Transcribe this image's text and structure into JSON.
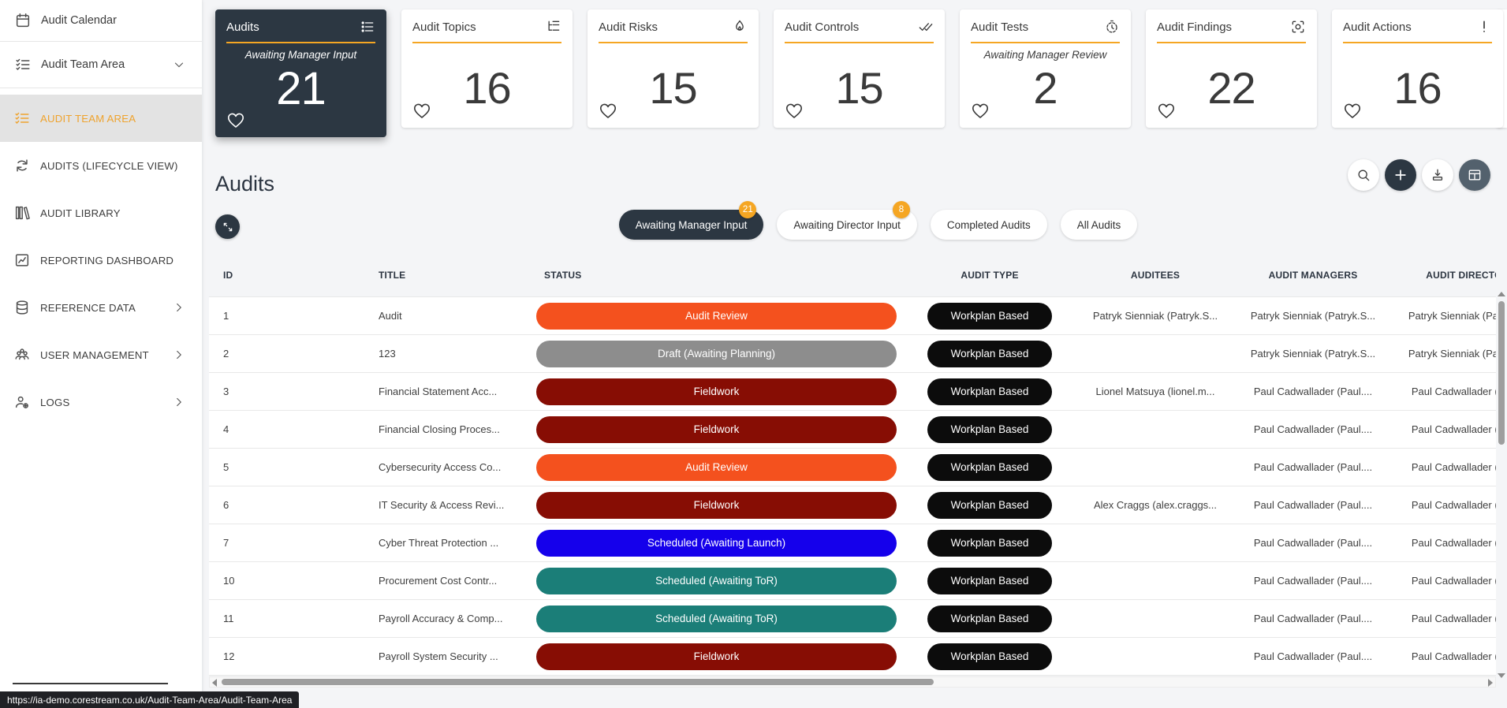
{
  "app": {
    "url_tooltip": "https://ia-demo.corestream.co.uk/Audit-Team-Area/Audit-Team-Area"
  },
  "colors": {
    "accent_orange": "#f5a623",
    "dark": "#2c3742",
    "slate": "#53616d",
    "active_item_text": "#efa32e",
    "page_bg": "#f4f5f7",
    "audit_type_pill": "#0c0c0c",
    "badge": "#f5a623",
    "status": {
      "audit_review": "#f4511e",
      "draft": "#8d8d8d",
      "fieldwork": "#870d04",
      "scheduled_launch": "#1500eb",
      "scheduled_tor": "#1b7e78"
    }
  },
  "sidebar": {
    "top_items": [
      {
        "label": "Audit Calendar",
        "icon": "calendar-icon"
      },
      {
        "label": "Audit Team Area",
        "icon": "checklist-icon",
        "chevron": "down"
      }
    ],
    "items": [
      {
        "label": "AUDIT TEAM AREA",
        "icon": "checklist-icon",
        "active": true
      },
      {
        "label": "AUDITS (LIFECYCLE VIEW)",
        "icon": "lifecycle-icon"
      },
      {
        "label": "AUDIT LIBRARY",
        "icon": "library-icon"
      },
      {
        "label": "REPORTING DASHBOARD",
        "icon": "chart-icon"
      },
      {
        "label": "REFERENCE DATA",
        "icon": "database-icon",
        "chevron": "right"
      },
      {
        "label": "USER MANAGEMENT",
        "icon": "users-icon",
        "chevron": "right"
      },
      {
        "label": "LOGS",
        "icon": "user-log-icon",
        "chevron": "right"
      }
    ]
  },
  "cards": [
    {
      "title": "Audits",
      "icon": "list-icon",
      "subtitle": "Awaiting Manager Input",
      "value": "21",
      "dark": true
    },
    {
      "title": "Audit Topics",
      "icon": "tree-list-icon",
      "subtitle": "",
      "value": "16"
    },
    {
      "title": "Audit Risks",
      "icon": "flame-icon",
      "subtitle": "",
      "value": "15"
    },
    {
      "title": "Audit Controls",
      "icon": "double-check-icon",
      "subtitle": "",
      "value": "15"
    },
    {
      "title": "Audit Tests",
      "icon": "timer-icon",
      "subtitle": "Awaiting Manager Review",
      "value": "2"
    },
    {
      "title": "Audit Findings",
      "icon": "focus-icon",
      "subtitle": "",
      "value": "22"
    },
    {
      "title": "Audit Actions",
      "icon": "exclamation-icon",
      "subtitle": "",
      "value": "16"
    }
  ],
  "main": {
    "title": "Audits",
    "toolbar": [
      {
        "name": "search",
        "icon": "search-icon",
        "style": "light"
      },
      {
        "name": "add",
        "icon": "plus-icon",
        "style": "dark"
      },
      {
        "name": "download",
        "icon": "download-icon",
        "style": "light"
      },
      {
        "name": "layout",
        "icon": "layout-icon",
        "style": "slate"
      }
    ],
    "filters": [
      {
        "label": "Awaiting Manager Input",
        "badge": "21",
        "selected": true
      },
      {
        "label": "Awaiting Director Input",
        "badge": "8"
      },
      {
        "label": "Completed Audits"
      },
      {
        "label": "All Audits"
      }
    ],
    "table": {
      "columns": [
        "ID",
        "TITLE",
        "STATUS",
        "AUDIT TYPE",
        "AUDITEES",
        "AUDIT MANAGERS",
        "AUDIT DIRECTORS"
      ],
      "rows": [
        {
          "id": "1",
          "title": "Audit",
          "status": "Audit Review",
          "status_key": "audit_review",
          "type": "Workplan Based",
          "auditees": "Patryk Sienniak (Patryk.S...",
          "managers": "Patryk Sienniak (Patryk.S...",
          "directors": "Patryk Sienniak (Patryk.S..."
        },
        {
          "id": "2",
          "title": "123",
          "status": "Draft (Awaiting Planning)",
          "status_key": "draft",
          "type": "Workplan Based",
          "auditees": "",
          "managers": "Patryk Sienniak (Patryk.S...",
          "directors": "Patryk Sienniak (Patryk.S..."
        },
        {
          "id": "3",
          "title": "Financial Statement Acc...",
          "status": "Fieldwork",
          "status_key": "fieldwork",
          "type": "Workplan Based",
          "auditees": "Lionel Matsuya (lionel.m...",
          "managers": "Paul Cadwallader (Paul....",
          "directors": "Paul Cadwallader (Paul...."
        },
        {
          "id": "4",
          "title": "Financial Closing Proces...",
          "status": "Fieldwork",
          "status_key": "fieldwork",
          "type": "Workplan Based",
          "auditees": "",
          "managers": "Paul Cadwallader (Paul....",
          "directors": "Paul Cadwallader (Paul...."
        },
        {
          "id": "5",
          "title": "Cybersecurity Access Co...",
          "status": "Audit Review",
          "status_key": "audit_review",
          "type": "Workplan Based",
          "auditees": "",
          "managers": "Paul Cadwallader (Paul....",
          "directors": "Paul Cadwallader (Paul...."
        },
        {
          "id": "6",
          "title": "IT Security & Access Revi...",
          "status": "Fieldwork",
          "status_key": "fieldwork",
          "type": "Workplan Based",
          "auditees": "Alex Craggs (alex.craggs...",
          "managers": "Paul Cadwallader (Paul....",
          "directors": "Paul Cadwallader (Paul...."
        },
        {
          "id": "7",
          "title": "Cyber Threat Protection ...",
          "status": "Scheduled (Awaiting Launch)",
          "status_key": "scheduled_launch",
          "type": "Workplan Based",
          "auditees": "",
          "managers": "Paul Cadwallader (Paul....",
          "directors": "Paul Cadwallader (Paul...."
        },
        {
          "id": "10",
          "title": "Procurement Cost Contr...",
          "status": "Scheduled (Awaiting ToR)",
          "status_key": "scheduled_tor",
          "type": "Workplan Based",
          "auditees": "",
          "managers": "Paul Cadwallader (Paul....",
          "directors": "Paul Cadwallader (Paul...."
        },
        {
          "id": "11",
          "title": "Payroll Accuracy & Comp...",
          "status": "Scheduled (Awaiting ToR)",
          "status_key": "scheduled_tor",
          "type": "Workplan Based",
          "auditees": "",
          "managers": "Paul Cadwallader (Paul....",
          "directors": "Paul Cadwallader (Paul...."
        },
        {
          "id": "12",
          "title": "Payroll System Security ...",
          "status": "Fieldwork",
          "status_key": "fieldwork",
          "type": "Workplan Based",
          "auditees": "",
          "managers": "Paul Cadwallader (Paul....",
          "directors": "Paul Cadwallader (Paul...."
        }
      ]
    }
  }
}
